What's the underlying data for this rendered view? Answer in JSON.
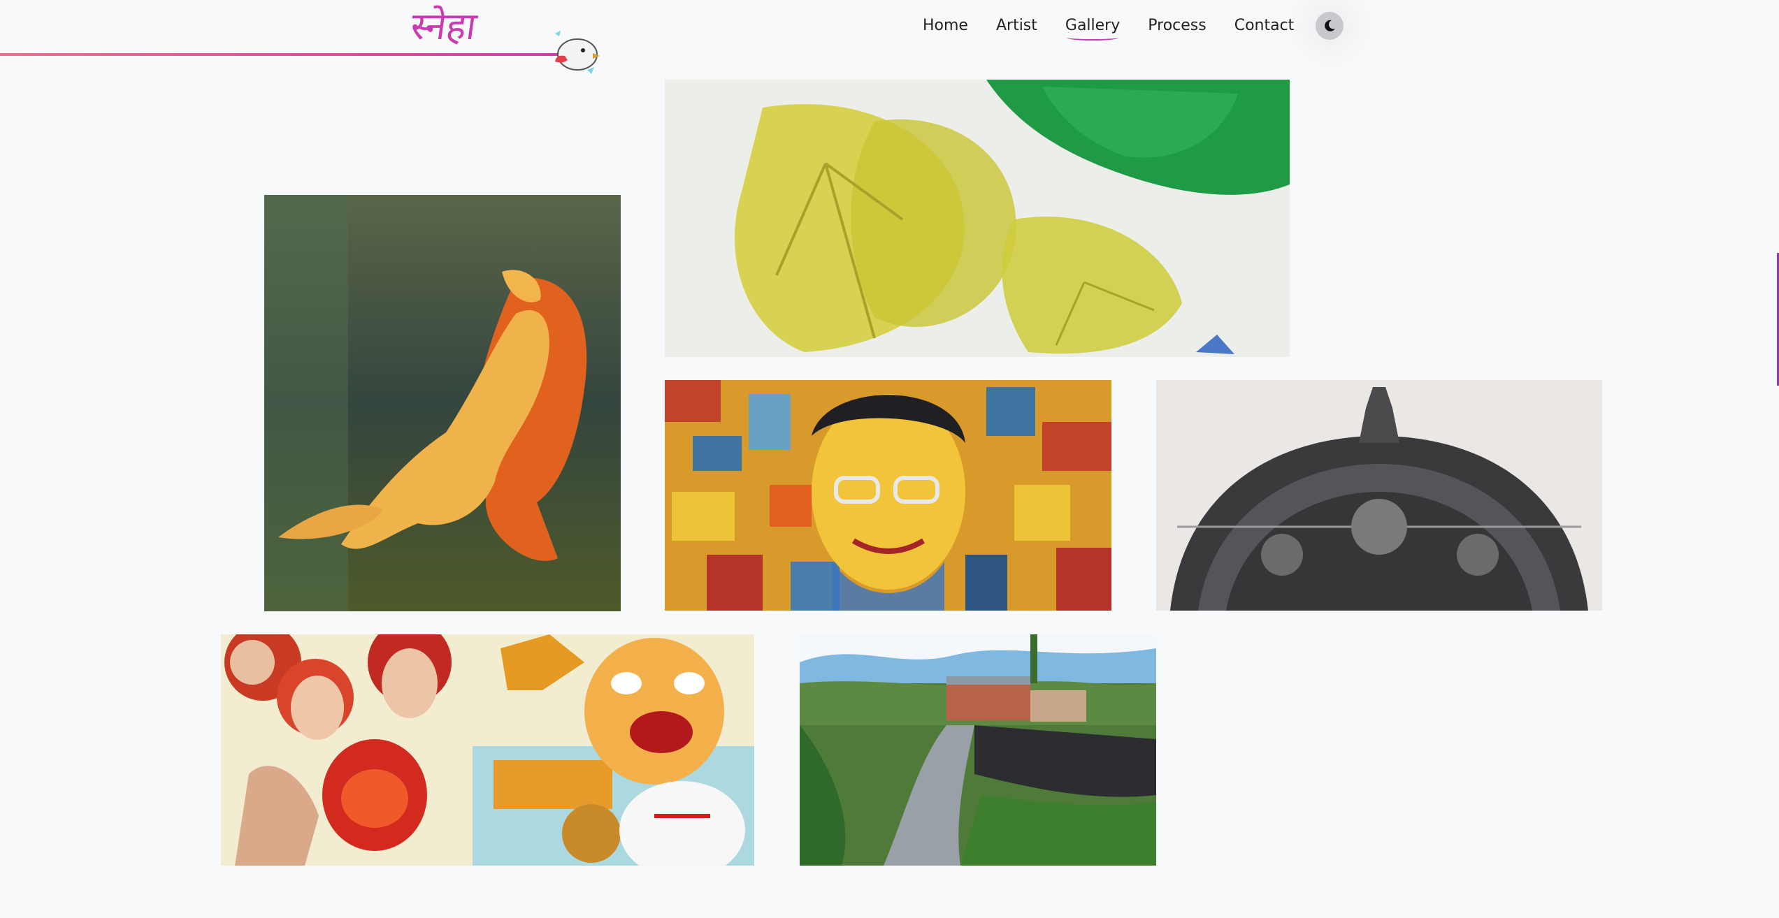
{
  "brand": {
    "logo_text": "स्नेहा"
  },
  "nav": {
    "items": [
      {
        "label": "Home",
        "active": false
      },
      {
        "label": "Artist",
        "active": false
      },
      {
        "label": "Gallery",
        "active": true
      },
      {
        "label": "Process",
        "active": false
      },
      {
        "label": "Contact",
        "active": false
      }
    ]
  },
  "theme_toggle": {
    "icon": "moon-icon"
  },
  "gallery": {
    "artworks": [
      {
        "name": "artwork-leaf-print"
      },
      {
        "name": "artwork-reclining-figure"
      },
      {
        "name": "artwork-impasto-portrait"
      },
      {
        "name": "artwork-carved-torana"
      },
      {
        "name": "artwork-nepali-festival-masks"
      },
      {
        "name": "artwork-village-landscape"
      }
    ]
  },
  "colors": {
    "accent": "#c93bb0",
    "line_start": "#ef6e8f",
    "background": "#f8f9fb"
  }
}
